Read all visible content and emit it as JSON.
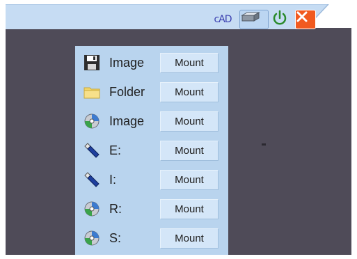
{
  "toolbar": {
    "cad_label": "cAD",
    "drive_icon": "drive-icon",
    "power_icon": "power-icon",
    "close_icon": "close-icon"
  },
  "mount_panel": {
    "rows": [
      {
        "icon": "floppy-disk-icon",
        "label": "Image",
        "button": "Mount"
      },
      {
        "icon": "folder-icon",
        "label": "Folder",
        "button": "Mount"
      },
      {
        "icon": "cd-disc-icon",
        "label": "Image",
        "button": "Mount"
      },
      {
        "icon": "usb-drive-icon",
        "label": "E:",
        "button": "Mount"
      },
      {
        "icon": "usb-drive-icon",
        "label": "I:",
        "button": "Mount"
      },
      {
        "icon": "cd-disc-icon",
        "label": "R:",
        "button": "Mount"
      },
      {
        "icon": "cd-disc-icon",
        "label": "S:",
        "button": "Mount"
      }
    ]
  },
  "colors": {
    "desktop": "#4f4b58",
    "panel": "#b9d4ee",
    "toolbar": "#bcd6f2",
    "close": "#f15a1f"
  }
}
